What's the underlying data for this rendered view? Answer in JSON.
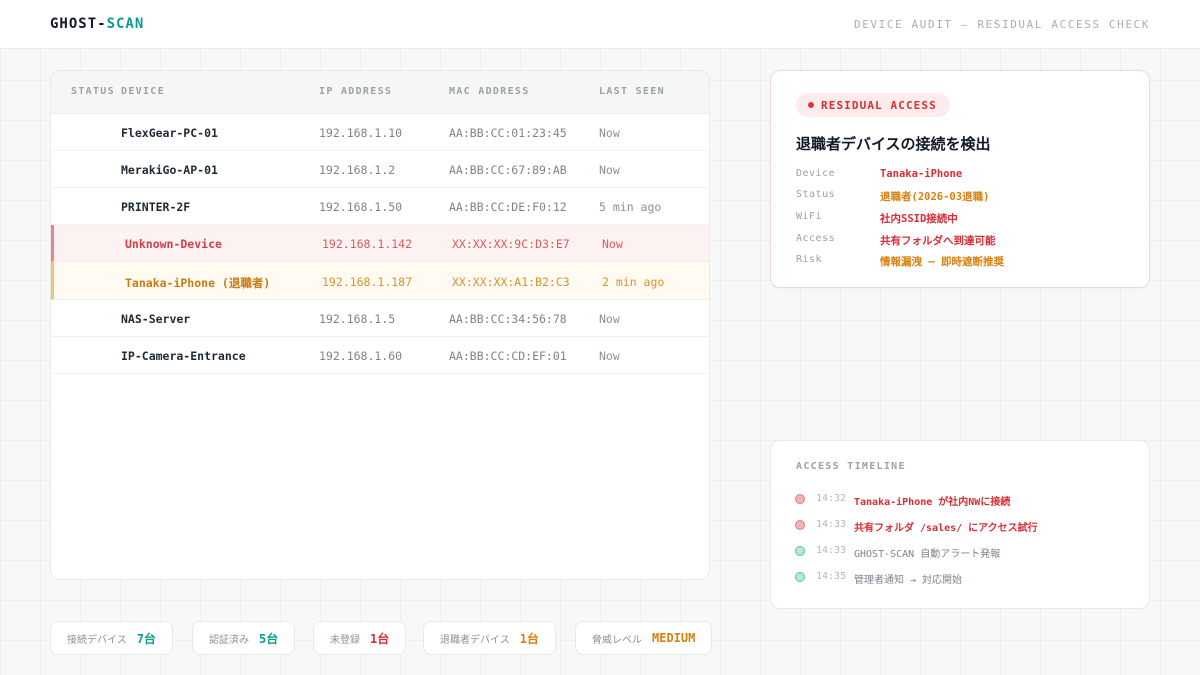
{
  "header": {
    "logo_main": "GHOST-",
    "logo_accent": "SCAN",
    "subtitle": "DEVICE AUDIT — RESIDUAL ACCESS CHECK"
  },
  "device_table": {
    "columns": [
      "STATUS",
      "DEVICE",
      "IP ADDRESS",
      "MAC ADDRESS",
      "LAST SEEN"
    ],
    "rows": [
      {
        "device": "FlexGear-PC-01",
        "ip": "192.168.1.10",
        "mac": "AA:BB:CC:01:23:45",
        "last_seen": "Now",
        "state": "normal"
      },
      {
        "device": "MerakiGo-AP-01",
        "ip": "192.168.1.2",
        "mac": "AA:BB:CC:67:89:AB",
        "last_seen": "Now",
        "state": "normal"
      },
      {
        "device": "PRINTER-2F",
        "ip": "192.168.1.50",
        "mac": "AA:BB:CC:DE:F0:12",
        "last_seen": "5 min ago",
        "state": "normal"
      },
      {
        "device": "Unknown-Device",
        "ip": "192.168.1.142",
        "mac": "XX:XX:XX:9C:D3:E7",
        "last_seen": "Now",
        "state": "alert"
      },
      {
        "device": "Tanaka-iPhone (退職者)",
        "ip": "192.168.1.187",
        "mac": "XX:XX:XX:A1:B2:C3",
        "last_seen": "2 min ago",
        "state": "warn"
      },
      {
        "device": "NAS-Server",
        "ip": "192.168.1.5",
        "mac": "AA:BB:CC:34:56:78",
        "last_seen": "Now",
        "state": "normal"
      },
      {
        "device": "IP-Camera-Entrance",
        "ip": "192.168.1.60",
        "mac": "AA:BB:CC:CD:EF:01",
        "last_seen": "Now",
        "state": "normal"
      }
    ]
  },
  "alert": {
    "badge": "RESIDUAL ACCESS",
    "title": "退職者デバイスの接続を検出",
    "details": [
      {
        "key": "Device",
        "value": "Tanaka-iPhone",
        "tone": "red"
      },
      {
        "key": "Status",
        "value": "退職者(2026-03退職)",
        "tone": "orange"
      },
      {
        "key": "WiFi",
        "value": "社内SSID接続中",
        "tone": "red"
      },
      {
        "key": "Access",
        "value": "共有フォルダへ到達可能",
        "tone": "red"
      },
      {
        "key": "Risk",
        "value": "情報漏洩 — 即時遮断推奨",
        "tone": "orange"
      }
    ]
  },
  "timeline": {
    "heading": "ACCESS TIMELINE",
    "events": [
      {
        "time": "14:32",
        "message": "Tanaka-iPhone が社内NWに接続",
        "tone": "red"
      },
      {
        "time": "14:33",
        "message": "共有フォルダ /sales/ にアクセス試行",
        "tone": "red"
      },
      {
        "time": "14:33",
        "message": "GHOST-SCAN 自動アラート発報",
        "tone": "teal"
      },
      {
        "time": "14:35",
        "message": "管理者通知 → 対応開始",
        "tone": "teal"
      }
    ]
  },
  "stats": [
    {
      "label": "接続デバイス",
      "value": "7台",
      "tone": "teal"
    },
    {
      "label": "認証済み",
      "value": "5台",
      "tone": "teal"
    },
    {
      "label": "未登録",
      "value": "1台",
      "tone": "red"
    },
    {
      "label": "退職者デバイス",
      "value": "1台",
      "tone": "orange"
    },
    {
      "label": "脅威レベル",
      "value": "MEDIUM",
      "tone": "orange"
    }
  ]
}
